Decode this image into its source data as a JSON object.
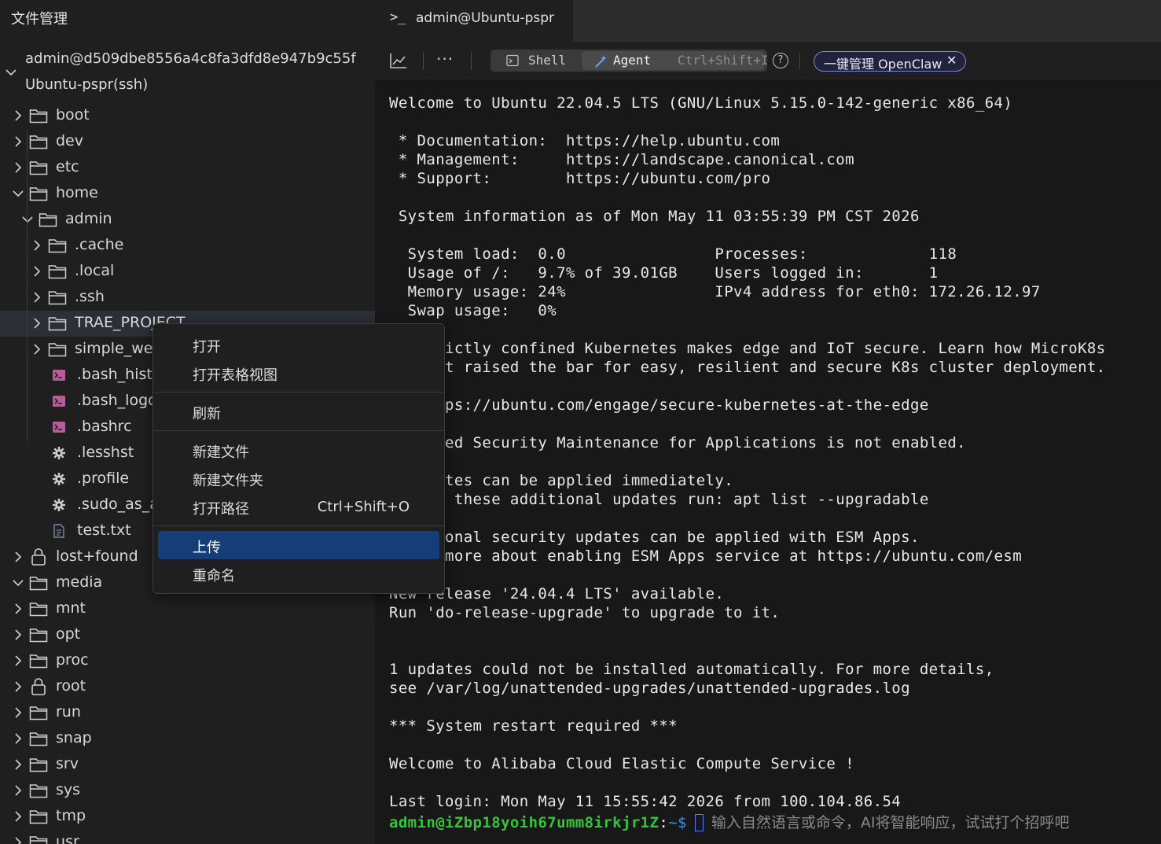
{
  "left_panel": {
    "title": "文件管理",
    "connection": {
      "line1": "admin@d509dbe8556a4c8fa3dfd8e947b9c55f",
      "line2": "Ubuntu-pspr(ssh)"
    },
    "tree": [
      {
        "label": "boot",
        "depth": 0,
        "icon": "folder-icon",
        "expanded": false
      },
      {
        "label": "dev",
        "depth": 0,
        "icon": "folder-icon",
        "expanded": false
      },
      {
        "label": "etc",
        "depth": 0,
        "icon": "folder-icon",
        "expanded": false
      },
      {
        "label": "home",
        "depth": 0,
        "icon": "folder-icon",
        "expanded": true
      },
      {
        "label": "admin",
        "depth": 1,
        "icon": "folder-icon",
        "expanded": true
      },
      {
        "label": ".cache",
        "depth": 2,
        "icon": "folder-icon",
        "expanded": false
      },
      {
        "label": ".local",
        "depth": 2,
        "icon": "folder-icon",
        "expanded": false
      },
      {
        "label": ".ssh",
        "depth": 2,
        "icon": "folder-icon",
        "expanded": false
      },
      {
        "label": "TRAE_PROJECT",
        "depth": 2,
        "icon": "folder-icon",
        "expanded": false,
        "highlighted": true
      },
      {
        "label": "simple_web",
        "depth": 2,
        "icon": "folder-icon",
        "expanded": false
      },
      {
        "label": ".bash_histo",
        "depth": 2,
        "icon": "terminal-file-icon"
      },
      {
        "label": ".bash_logou",
        "depth": 2,
        "icon": "terminal-file-icon"
      },
      {
        "label": ".bashrc",
        "depth": 2,
        "icon": "terminal-file-icon"
      },
      {
        "label": ".lesshst",
        "depth": 2,
        "icon": "gear-icon"
      },
      {
        "label": ".profile",
        "depth": 2,
        "icon": "gear-icon"
      },
      {
        "label": ".sudo_as_ac",
        "depth": 2,
        "icon": "gear-icon"
      },
      {
        "label": "test.txt",
        "depth": 2,
        "icon": "text-file-icon"
      },
      {
        "label": "lost+found",
        "depth": 0,
        "icon": "lock-icon",
        "expanded": false
      },
      {
        "label": "media",
        "depth": 0,
        "icon": "folder-icon",
        "expanded": true
      },
      {
        "label": "mnt",
        "depth": 0,
        "icon": "folder-icon",
        "expanded": false
      },
      {
        "label": "opt",
        "depth": 0,
        "icon": "folder-icon",
        "expanded": false
      },
      {
        "label": "proc",
        "depth": 0,
        "icon": "folder-icon",
        "expanded": false
      },
      {
        "label": "root",
        "depth": 0,
        "icon": "lock-icon",
        "expanded": false
      },
      {
        "label": "run",
        "depth": 0,
        "icon": "folder-icon",
        "expanded": false
      },
      {
        "label": "snap",
        "depth": 0,
        "icon": "folder-icon",
        "expanded": false
      },
      {
        "label": "srv",
        "depth": 0,
        "icon": "folder-icon",
        "expanded": false
      },
      {
        "label": "sys",
        "depth": 0,
        "icon": "folder-icon",
        "expanded": false
      },
      {
        "label": "tmp",
        "depth": 0,
        "icon": "folder-icon",
        "expanded": false
      },
      {
        "label": "usr",
        "depth": 0,
        "icon": "folder-icon",
        "expanded": false
      }
    ]
  },
  "tab": {
    "prompt_icon": ">_",
    "title": "admin@Ubuntu-pspr"
  },
  "toolbar": {
    "chart_icon": "chart-icon",
    "more_label": "···",
    "shell_label": "Shell",
    "agent_label": "Agent",
    "agent_shortcut": "Ctrl+Shift+I",
    "help_label": "?",
    "openclaw_label": "一键管理 OpenClaw",
    "openclaw_close": "✕"
  },
  "terminal": {
    "lines": [
      "Welcome to Ubuntu 22.04.5 LTS (GNU/Linux 5.15.0-142-generic x86_64)",
      "",
      " * Documentation:  https://help.ubuntu.com",
      " * Management:     https://landscape.canonical.com",
      " * Support:        https://ubuntu.com/pro",
      "",
      " System information as of Mon May 11 03:55:39 PM CST 2026",
      "",
      "  System load:  0.0                Processes:             118",
      "  Usage of /:   9.7% of 39.01GB    Users logged in:       1",
      "  Memory usage: 24%                IPv4 address for eth0: 172.26.12.97",
      "  Swap usage:   0%",
      "",
      " * Strictly confined Kubernetes makes edge and IoT secure. Learn how MicroK8s",
      "   just raised the bar for easy, resilient and secure K8s cluster deployment.",
      "",
      "   https://ubuntu.com/engage/secure-kubernetes-at-the-edge",
      "",
      "Expanded Security Maintenance for Applications is not enabled.",
      "",
      "0 updates can be applied immediately.",
      "To see these additional updates run: apt list --upgradable",
      "",
      "Additional security updates can be applied with ESM Apps.",
      "Learn more about enabling ESM Apps service at https://ubuntu.com/esm",
      "",
      "New release '24.04.4 LTS' available.",
      "Run 'do-release-upgrade' to upgrade to it.",
      "",
      "",
      "1 updates could not be installed automatically. For more details,",
      "see /var/log/unattended-upgrades/unattended-upgrades.log",
      "",
      "*** System restart required ***",
      "",
      "Welcome to Alibaba Cloud Elastic Compute Service !",
      "",
      "Last login: Mon May 11 15:55:42 2026 from 100.104.86.54"
    ],
    "prompt_user": "admin@iZbp18yoih67umm8irkjr1Z",
    "prompt_sep": ":",
    "prompt_path": "~$",
    "input_placeholder": "输入自然语言或命令，AI将智能响应，试试打个招呼吧"
  },
  "context_menu": {
    "groups": [
      [
        {
          "label": "打开"
        },
        {
          "label": "打开表格视图"
        }
      ],
      [
        {
          "label": "刷新"
        }
      ],
      [
        {
          "label": "新建文件"
        },
        {
          "label": "新建文件夹"
        },
        {
          "label": "打开路径",
          "shortcut": "Ctrl+Shift+O"
        }
      ],
      [
        {
          "label": "上传",
          "selected": true
        },
        {
          "label": "重命名"
        }
      ]
    ]
  },
  "colors": {
    "panel_bg": "#1f1f1f",
    "terminal_bg": "#181818",
    "prompt_green": "#35c43a",
    "prompt_blue": "#3b8eea",
    "menu_selected": "#153d77",
    "accent_purple": "#7d83e0"
  }
}
